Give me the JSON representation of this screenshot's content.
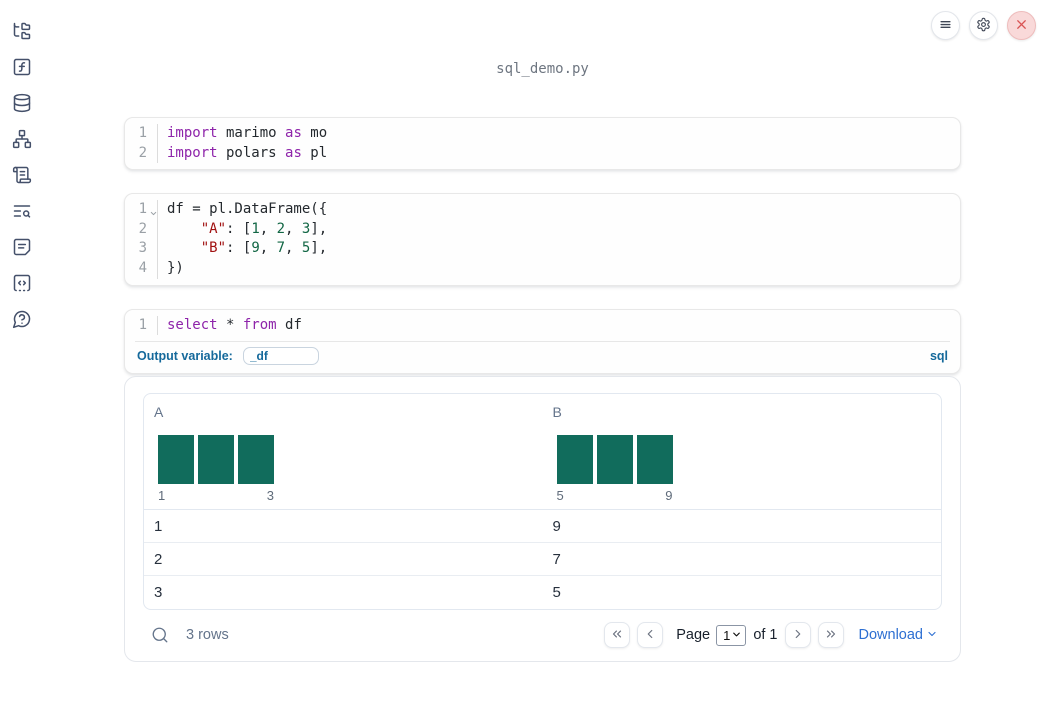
{
  "colors": {
    "histogram-bar": "#116c5c",
    "sql-accent": "#15699b",
    "download-link": "#2d6fd2",
    "keyword": "#8e24aa",
    "string": "#a11111",
    "number": "#116644"
  },
  "window": {
    "title": "sql_demo.py"
  },
  "sidebar": {
    "items": [
      {
        "name": "file-explorer",
        "icon": "folder-tree-icon"
      },
      {
        "name": "variables",
        "icon": "function-square-icon"
      },
      {
        "name": "datasources",
        "icon": "database-icon"
      },
      {
        "name": "dependency-graph",
        "icon": "network-icon"
      },
      {
        "name": "scratchpad",
        "icon": "scroll-text-icon"
      },
      {
        "name": "table-of-contents",
        "icon": "text-search-icon"
      },
      {
        "name": "documentation",
        "icon": "file-text-icon"
      },
      {
        "name": "snippets",
        "icon": "code-snippet-icon"
      },
      {
        "name": "help",
        "icon": "help-bubble-icon"
      }
    ]
  },
  "code": {
    "cell1": {
      "lines": [
        {
          "n": "1",
          "tokens": [
            {
              "c": "kw",
              "t": "import"
            },
            {
              "c": "pl",
              "t": " marimo "
            },
            {
              "c": "kw",
              "t": "as"
            },
            {
              "c": "pl",
              "t": " mo"
            }
          ]
        },
        {
          "n": "2",
          "tokens": [
            {
              "c": "kw",
              "t": "import"
            },
            {
              "c": "pl",
              "t": " polars "
            },
            {
              "c": "kw",
              "t": "as"
            },
            {
              "c": "pl",
              "t": " pl"
            }
          ]
        }
      ]
    },
    "cell2": {
      "lines": [
        {
          "n": "1",
          "tokens": [
            {
              "c": "pl",
              "t": "df = pl.DataFrame({"
            }
          ]
        },
        {
          "n": "2",
          "tokens": [
            {
              "c": "pl",
              "t": "    "
            },
            {
              "c": "str",
              "t": "\"A\""
            },
            {
              "c": "pl",
              "t": ": ["
            },
            {
              "c": "num",
              "t": "1"
            },
            {
              "c": "pl",
              "t": ", "
            },
            {
              "c": "num",
              "t": "2"
            },
            {
              "c": "pl",
              "t": ", "
            },
            {
              "c": "num",
              "t": "3"
            },
            {
              "c": "pl",
              "t": "],"
            }
          ]
        },
        {
          "n": "3",
          "tokens": [
            {
              "c": "pl",
              "t": "    "
            },
            {
              "c": "str",
              "t": "\"B\""
            },
            {
              "c": "pl",
              "t": ": ["
            },
            {
              "c": "num",
              "t": "9"
            },
            {
              "c": "pl",
              "t": ", "
            },
            {
              "c": "num",
              "t": "7"
            },
            {
              "c": "pl",
              "t": ", "
            },
            {
              "c": "num",
              "t": "5"
            },
            {
              "c": "pl",
              "t": "],"
            }
          ]
        },
        {
          "n": "4",
          "tokens": [
            {
              "c": "pl",
              "t": "})"
            }
          ]
        }
      ]
    },
    "cell3": {
      "lines": [
        {
          "n": "1",
          "tokens": [
            {
              "c": "kw",
              "t": "select"
            },
            {
              "c": "pl",
              "t": " * "
            },
            {
              "c": "kw",
              "t": "from"
            },
            {
              "c": "pl",
              "t": " df"
            }
          ]
        }
      ]
    }
  },
  "sql_cell": {
    "output_variable_label": "Output variable:",
    "output_variable_value": "_df",
    "language_badge": "sql"
  },
  "table": {
    "columns": [
      {
        "label": "A",
        "hist_min": "1",
        "hist_max": "3",
        "hist_bars": [
          1,
          1,
          1
        ]
      },
      {
        "label": "B",
        "hist_min": "5",
        "hist_max": "9",
        "hist_bars": [
          1,
          1,
          1
        ]
      }
    ],
    "rows": [
      [
        "1",
        "9"
      ],
      [
        "2",
        "7"
      ],
      [
        "3",
        "5"
      ]
    ],
    "status": "3 rows",
    "pagination": {
      "page_label": "Page",
      "page_value": "1",
      "of_label": "of 1"
    },
    "download_label": "Download"
  }
}
